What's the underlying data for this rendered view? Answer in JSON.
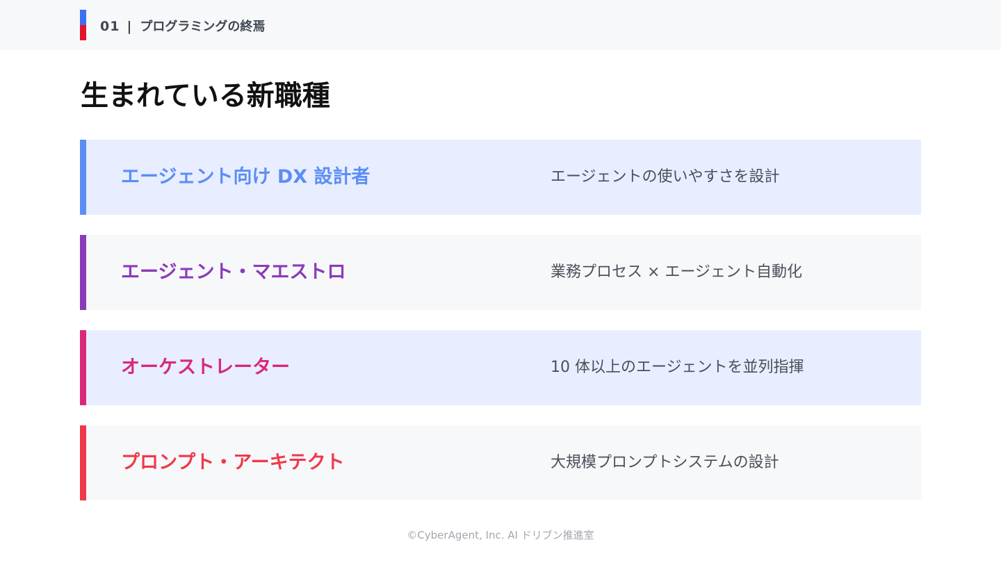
{
  "header": {
    "section_number": "01",
    "separator": "|",
    "section_title": "プログラミングの終焉",
    "accent_colors": [
      "#3b6ff5",
      "#e5142a"
    ]
  },
  "page_title": "生まれている新職種",
  "roles": [
    {
      "title": "エージェント向け DX 設計者",
      "description": "エージェントの使いやすさを設計",
      "accent_color": "#5b8ef5",
      "background": "#e8eeff"
    },
    {
      "title": "エージェント・マエストロ",
      "description": "業務プロセス × エージェント自動化",
      "accent_color": "#8a3bb8",
      "background": "#f7f8fa"
    },
    {
      "title": "オーケストレーター",
      "description": "10 体以上のエージェントを並列指揮",
      "accent_color": "#d9287a",
      "background": "#e8eeff"
    },
    {
      "title": "プロンプト・アーキテクト",
      "description": "大規模プロンプトシステムの設計",
      "accent_color": "#f0384a",
      "background": "#f7f8fa"
    }
  ],
  "footer": {
    "copyright": "©CyberAgent, Inc. AI ドリブン推進室"
  }
}
